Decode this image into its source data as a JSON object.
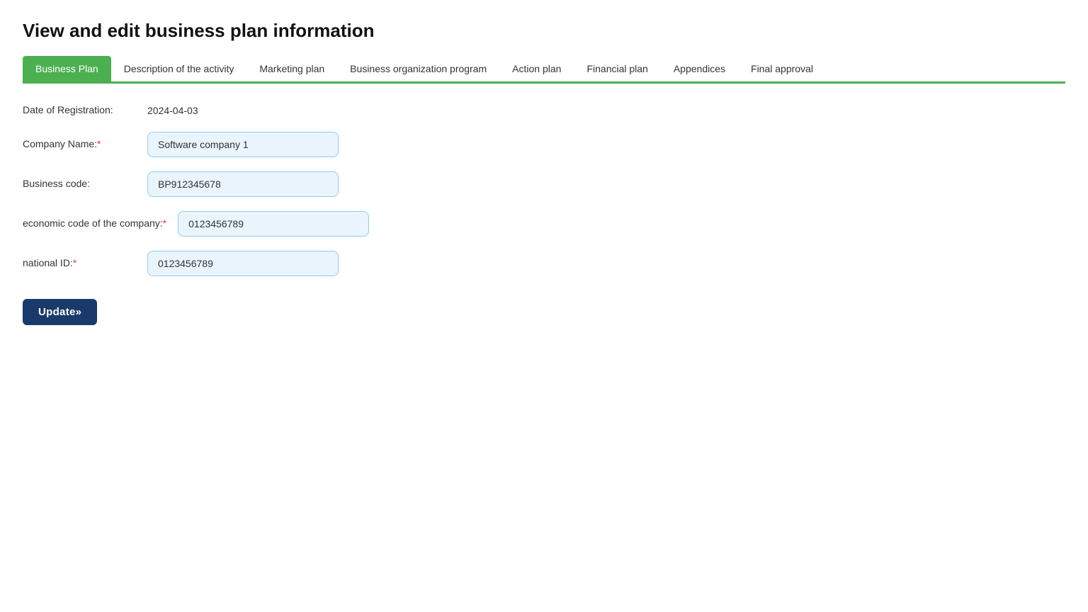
{
  "page": {
    "title": "View and edit business plan information"
  },
  "tabs": [
    {
      "id": "business-plan",
      "label": "Business Plan",
      "active": true
    },
    {
      "id": "description",
      "label": "Description of the activity",
      "active": false
    },
    {
      "id": "marketing",
      "label": "Marketing plan",
      "active": false
    },
    {
      "id": "biz-org",
      "label": "Business organization program",
      "active": false
    },
    {
      "id": "action-plan",
      "label": "Action plan",
      "active": false
    },
    {
      "id": "financial",
      "label": "Financial plan",
      "active": false
    },
    {
      "id": "appendices",
      "label": "Appendices",
      "active": false
    },
    {
      "id": "final-approval",
      "label": "Final approval",
      "active": false
    }
  ],
  "form": {
    "date_of_registration": {
      "label": "Date of Registration:",
      "value": "2024-04-03",
      "required": false
    },
    "company_name": {
      "label": "Company Name:",
      "value": "Software company 1",
      "required": true
    },
    "business_code": {
      "label": "Business code:",
      "value": "BP912345678",
      "required": false
    },
    "economic_code": {
      "label": "economic code of the company:",
      "value": "0123456789",
      "required": true
    },
    "national_id": {
      "label": "national ID:",
      "value": "0123456789",
      "required": true
    }
  },
  "buttons": {
    "update_label": "Update»"
  }
}
